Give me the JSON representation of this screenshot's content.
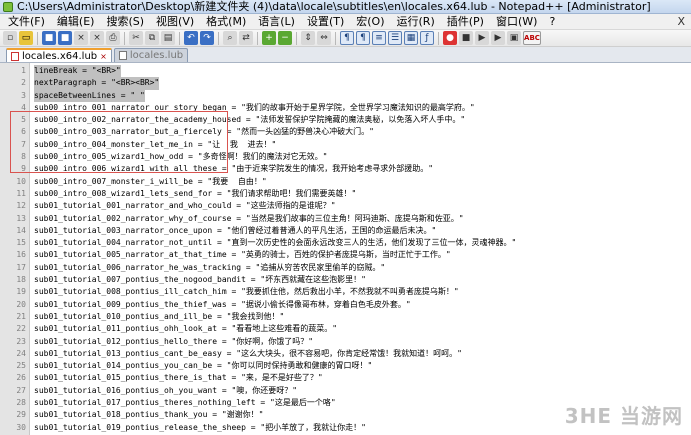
{
  "window": {
    "title": "C:\\Users\\Administrator\\Desktop\\新建文件夹 (4)\\data\\locale\\subtitles\\en\\locales.x64.lub - Notepad++ [Administrator]"
  },
  "menu": {
    "items": [
      "文件(F)",
      "编辑(E)",
      "搜索(S)",
      "视图(V)",
      "格式(M)",
      "语言(L)",
      "设置(T)",
      "宏(O)",
      "运行(R)",
      "插件(P)",
      "窗口(W)",
      "?"
    ],
    "close_label": "X"
  },
  "toolbar": {
    "buttons": [
      "new",
      "open",
      "save",
      "save-all",
      "close",
      "close-all",
      "print",
      "cut",
      "copy",
      "paste",
      "undo",
      "redo",
      "find",
      "replace",
      "zoom-in",
      "zoom-out",
      "sync-v",
      "sync-h",
      "word-wrap",
      "show-all",
      "indent-guide",
      "udl",
      "doc-map",
      "func-list",
      "record",
      "stop",
      "play",
      "play-multi",
      "save-macro",
      "spell-check"
    ]
  },
  "tabs": [
    {
      "label": "locales.x64.lub",
      "active": true
    },
    {
      "label": "locales.lub",
      "active": false
    }
  ],
  "editor": {
    "lines": [
      {
        "n": "1",
        "text": "lineBreak = \"<BR>\""
      },
      {
        "n": "2",
        "text": "nextParagraph = \"<BR><BR>\""
      },
      {
        "n": "3",
        "text": "spaceBetweenLines = \" \""
      },
      {
        "n": "4",
        "text": "sub00_intro_001_narrator_our_story_began = \"我们的故事开始于星界学院，全世界学习魔法知识的最高学府。\""
      },
      {
        "n": "5",
        "text": "sub00_intro_002_narrator_the_academy_housed = \"法师发誓保护学院掩藏的魔法奥秘，以免落入坏人手中。\""
      },
      {
        "n": "6",
        "text": "sub00_intro_003_narrator_but_a_fiercely = \"然而一头凶猛的野兽决心冲破大门。\""
      },
      {
        "n": "7",
        "text": "sub00_intro_004_monster_let_me_in = \"让  我  进去！\""
      },
      {
        "n": "8",
        "text": "sub00_intro_005_wizard1_how_odd = \"多奇怪啊！我们的魔法对它无效。\""
      },
      {
        "n": "9",
        "text": "sub00_intro_006_wizard1_with_all_these = \"由于近来学院发生的情况，我开始考虑寻求外部援助。\""
      },
      {
        "n": "10",
        "text": "sub00_intro_007_monster_i_will_be = \"我要  自由！\""
      },
      {
        "n": "11",
        "text": "sub00_intro_008_wizard1_lets_send_for = \"我们请求帮助吧！我们需要英雄！\""
      },
      {
        "n": "12",
        "text": "sub01_tutorial_001_narrator_and_who_could = \"这些法师指的是谁呢？\""
      },
      {
        "n": "13",
        "text": "sub01_tutorial_002_narrator_why_of_course = \"当然是我们故事的三位主角！阿玛迪斯、庞提乌斯和佐亚。\""
      },
      {
        "n": "14",
        "text": "sub01_tutorial_003_narrator_once_upon = \"他们曾经过着普通人的平凡生活，王国的命运最后未决。\""
      },
      {
        "n": "15",
        "text": "sub01_tutorial_004_narrator_not_until = \"直到一次历史性的会面永远改变三人的生活，他们发现了三位一体，灵魂神器。\""
      },
      {
        "n": "16",
        "text": "sub01_tutorial_005_narrator_at_that_time = \"英勇的骑士，百姓的保护者庞提乌斯，当时正忙于工作。\""
      },
      {
        "n": "17",
        "text": "sub01_tutorial_006_narrator_he_was_tracking = \"追捕从穷苦农民家里偷羊的窃贼。\""
      },
      {
        "n": "18",
        "text": "sub01_tutorial_007_pontius_the_nogood_bandit = \"坏东西就藏在这些泡影里！\""
      },
      {
        "n": "19",
        "text": "sub01_tutorial_008_pontius_ill_catch_him = \"我要抓住他，然后救出小羊，不然我就不叫勇者庞提乌斯！\""
      },
      {
        "n": "20",
        "text": "sub01_tutorial_009_pontius_the_thief_was = \"据说小偷长得像哥布林，穿着白色毛皮外套。\""
      },
      {
        "n": "21",
        "text": "sub01_tutorial_010_pontius_and_ill_be = \"我会找到他！\""
      },
      {
        "n": "22",
        "text": "sub01_tutorial_011_pontius_ohh_look_at = \"看看地上这些难看的蔬菜。\""
      },
      {
        "n": "23",
        "text": "sub01_tutorial_012_pontius_hello_there = \"你好啊，你饿了吗？\""
      },
      {
        "n": "24",
        "text": "sub01_tutorial_013_pontius_cant_be_easy = \"这么大块头，很不容易吧，你肯定经常饿！我就知道！呵呵。\""
      },
      {
        "n": "25",
        "text": "sub01_tutorial_014_pontius_you_can_be = \"你可以同时保持勇敢和健康的胃口呀！\""
      },
      {
        "n": "26",
        "text": "sub01_tutorial_015_pontius_there_is_that = \"来，是不是好些了？\""
      },
      {
        "n": "27",
        "text": "sub01_tutorial_016_pontius_oh_you_want = \"噢，你还要呀？\""
      },
      {
        "n": "28",
        "text": "sub01_tutorial_017_pontius_theres_nothing_left = \"这是最后一个咯\""
      },
      {
        "n": "29",
        "text": "sub01_tutorial_018_pontius_thank_you = \"谢谢你！\""
      },
      {
        "n": "30",
        "text": "sub01_tutorial_019_pontius_release_the_sheep = \"把小羊放了，我就让你走！\""
      }
    ]
  },
  "watermark": "3HE 当游网",
  "colors": {
    "selection": "#c0c0c0",
    "gutter": "#e4e4e4",
    "tab_accent": "#f0a030",
    "highlight_box": "#d9534f"
  }
}
